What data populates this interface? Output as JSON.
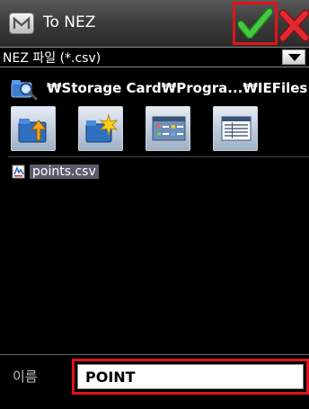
{
  "window": {
    "title": "To NEZ",
    "app_icon": "menu-m-icon"
  },
  "titlebar": {
    "ok_icon": "checkmark-icon",
    "cancel_icon": "close-x-icon",
    "ok_color": "#2fa82c",
    "cancel_color": "#d8262c"
  },
  "file_type": {
    "selected": "NEZ 파일 (*.csv)",
    "icon": "dropdown-arrow-icon"
  },
  "path": {
    "text": "₩Storage Card₩Progra...₩IEFiles",
    "icon": "folder-search-icon"
  },
  "toolbar": [
    {
      "name": "up-folder-icon"
    },
    {
      "name": "new-folder-icon"
    },
    {
      "name": "list-view-icon"
    },
    {
      "name": "detail-view-icon"
    }
  ],
  "files": [
    {
      "name": "points.csv",
      "icon": "csv-file-icon"
    }
  ],
  "name_field": {
    "label": "이름",
    "value": "POINT"
  },
  "highlight_color": "#e0141c"
}
